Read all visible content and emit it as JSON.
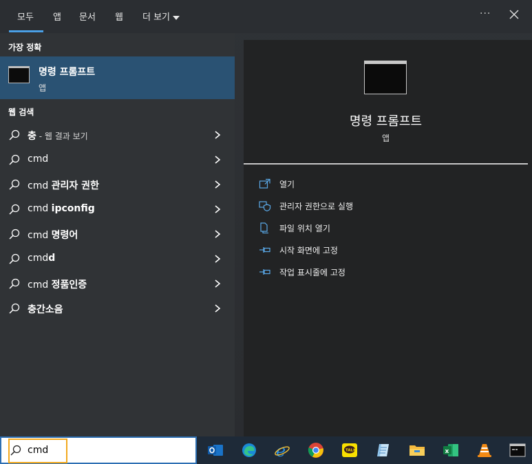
{
  "tabs": [
    {
      "label": "모두"
    },
    {
      "label": "앱"
    },
    {
      "label": "문서"
    },
    {
      "label": "웹"
    },
    {
      "label": "더 보기"
    }
  ],
  "topbar": {
    "ellipsis": "···",
    "close_icon": "close-icon"
  },
  "best_match": {
    "section_title": "가장 정확",
    "name": "명령 프롬프트",
    "type": "앱",
    "icon": "cmd-icon"
  },
  "web_search": {
    "section_title": "웹 검색",
    "items": [
      {
        "prefix": "",
        "bold": "충",
        "suffix": " - 웹 결과 보기"
      },
      {
        "prefix": "cmd",
        "bold": "",
        "suffix": ""
      },
      {
        "prefix": "cmd ",
        "bold": "관리자 권한",
        "suffix": ""
      },
      {
        "prefix": "cmd ",
        "bold": "ipconfig",
        "suffix": ""
      },
      {
        "prefix": "cmd ",
        "bold": "명령어",
        "suffix": ""
      },
      {
        "prefix": "cmd",
        "bold": "d",
        "suffix": ""
      },
      {
        "prefix": "cmd ",
        "bold": "정품인증",
        "suffix": ""
      },
      {
        "prefix": "",
        "bold": "충간소음",
        "suffix": ""
      }
    ]
  },
  "preview": {
    "title": "명령 프롬프트",
    "subtitle": "앱",
    "actions": [
      {
        "label": "열기",
        "icon": "open-icon"
      },
      {
        "label": "관리자 권한으로 실행",
        "icon": "shield-icon"
      },
      {
        "label": "파일 위치 열기",
        "icon": "file-location-icon"
      },
      {
        "label": "시작 화면에 고정",
        "icon": "pin-icon"
      },
      {
        "label": "작업 표시줄에 고정",
        "icon": "pin-icon"
      }
    ]
  },
  "taskbar": {
    "search_value": "cmd",
    "apps": [
      "outlook-icon",
      "edge-icon",
      "internet-explorer-icon",
      "chrome-icon",
      "kakaotalk-icon",
      "notepad-icon",
      "file-explorer-icon",
      "excel-icon",
      "vlc-icon",
      "terminal-icon"
    ]
  },
  "colors": {
    "accent": "#4aa0e6",
    "selected_item_bg": "#2a5273",
    "focus_ring": "#f2a81d"
  }
}
